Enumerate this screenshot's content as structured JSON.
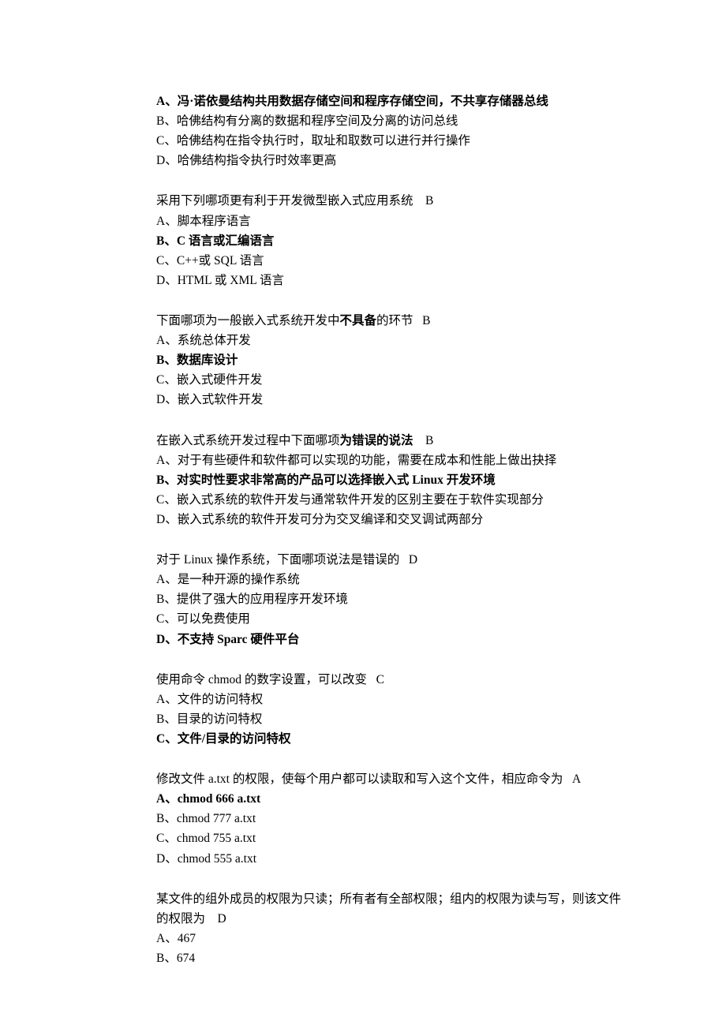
{
  "blocks": [
    {
      "lines": [
        {
          "text": "A、冯·诺依曼结构共用数据存储空间和程序存储空间，不共享存储器总线",
          "bold": true
        },
        {
          "text": "B、哈佛结构有分离的数据和程序空间及分离的访问总线",
          "bold": false
        },
        {
          "text": "C、哈佛结构在指令执行时，取址和取数可以进行并行操作",
          "bold": false
        },
        {
          "text": "D、哈佛结构指令执行时效率更高",
          "bold": false
        }
      ]
    },
    {
      "question": {
        "pre": "采用下列哪项更有利于开发微型嵌入式应用系统    ",
        "ans": "B"
      },
      "lines": [
        {
          "text": "A、脚本程序语言",
          "bold": false
        },
        {
          "text": "B、C 语言或汇编语言",
          "bold": true
        },
        {
          "text": "C、C++或 SQL 语言",
          "bold": false
        },
        {
          "text": "D、HTML 或 XML 语言",
          "bold": false
        }
      ]
    },
    {
      "question": {
        "preParts": [
          {
            "t": "下面哪项为一般嵌入式系统开发中",
            "b": false
          },
          {
            "t": "不具备",
            "b": true
          },
          {
            "t": "的环节   ",
            "b": false
          }
        ],
        "ans": "B"
      },
      "lines": [
        {
          "text": "A、系统总体开发",
          "bold": false
        },
        {
          "text": "B、数据库设计",
          "bold": true
        },
        {
          "text": "C、嵌入式硬件开发",
          "bold": false
        },
        {
          "text": "D、嵌入式软件开发",
          "bold": false
        }
      ]
    },
    {
      "question": {
        "preParts": [
          {
            "t": "在嵌入式系统开发过程中下面哪项",
            "b": false
          },
          {
            "t": "为错误的说法    ",
            "b": true
          }
        ],
        "ans": "B"
      },
      "lines": [
        {
          "text": "A、对于有些硬件和软件都可以实现的功能，需要在成本和性能上做出抉择",
          "bold": false
        },
        {
          "text": "B、对实时性要求非常高的产品可以选择嵌入式 Linux 开发环境",
          "bold": true
        },
        {
          "text": "C、嵌入式系统的软件开发与通常软件开发的区别主要在于软件实现部分",
          "bold": false
        },
        {
          "text": "D、嵌入式系统的软件开发可分为交叉编译和交叉调试两部分",
          "bold": false
        }
      ]
    },
    {
      "question": {
        "pre": "对于 Linux 操作系统，下面哪项说法是错误的   ",
        "ans": "D"
      },
      "lines": [
        {
          "text": "A、是一种开源的操作系统",
          "bold": false
        },
        {
          "text": "B、提供了强大的应用程序开发环境",
          "bold": false
        },
        {
          "text": "C、可以免费使用",
          "bold": false
        },
        {
          "text": "D、不支持 Sparc 硬件平台",
          "bold": true
        }
      ]
    },
    {
      "question": {
        "pre": "使用命令 chmod 的数字设置，可以改变   ",
        "ans": "C"
      },
      "lines": [
        {
          "text": "A、文件的访问特权",
          "bold": false
        },
        {
          "text": "B、目录的访问特权",
          "bold": false
        },
        {
          "text": "C、文件/目录的访问特权",
          "bold": true
        }
      ]
    },
    {
      "question": {
        "pre": "修改文件 a.txt 的权限，使每个用户都可以读取和写入这个文件，相应命令为   ",
        "ans": "A"
      },
      "lines": [
        {
          "text": "A、chmod 666 a.txt",
          "bold": true
        },
        {
          "text": "B、chmod 777 a.txt",
          "bold": false
        },
        {
          "text": "C、chmod 755 a.txt",
          "bold": false
        },
        {
          "text": "D、chmod 555 a.txt",
          "bold": false
        }
      ]
    },
    {
      "question": {
        "pre": "某文件的组外成员的权限为只读；所有者有全部权限；组内的权限为读与写，则该文件的权限为    ",
        "ans": "D"
      },
      "lines": [
        {
          "text": "A、467",
          "bold": false
        },
        {
          "text": "B、674",
          "bold": false
        }
      ]
    }
  ]
}
